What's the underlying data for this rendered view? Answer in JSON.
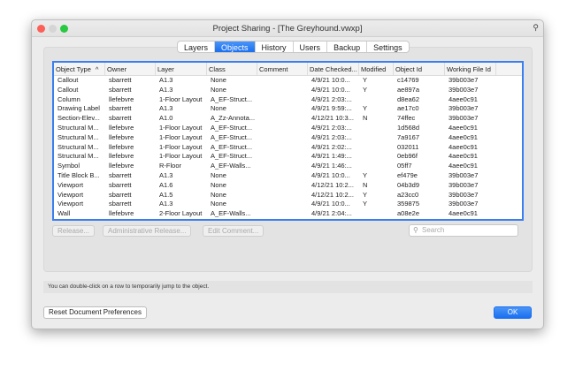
{
  "window": {
    "title": "Project Sharing - [The Greyhound.vwxp]"
  },
  "tabs": [
    {
      "label": "Layers"
    },
    {
      "label": "Objects"
    },
    {
      "label": "History"
    },
    {
      "label": "Users"
    },
    {
      "label": "Backup"
    },
    {
      "label": "Settings"
    }
  ],
  "active_tab": "Objects",
  "table": {
    "columns": [
      "Object Type",
      "Owner",
      "Layer",
      "Class",
      "Comment",
      "Date Checked...",
      "Modified",
      "Object Id",
      "Working File Id"
    ],
    "sort_indicator": "^",
    "rows": [
      [
        "Callout",
        "sbarrett",
        "A1.3",
        "None",
        "",
        "4/9/21  10:0...",
        "Y",
        "c14769",
        "39b003e7"
      ],
      [
        "Callout",
        "sbarrett",
        "A1.3",
        "None",
        "",
        "4/9/21  10:0...",
        "Y",
        "ae897a",
        "39b003e7"
      ],
      [
        "Column",
        "llefebvre",
        "1-Floor Layout",
        "A_EF-Struct...",
        "",
        "4/9/21  2:03:...",
        "",
        "d8ea62",
        "4aee0c91"
      ],
      [
        "Drawing Label",
        "sbarrett",
        "A1.3",
        "None",
        "",
        "4/9/21  9:59:...",
        "Y",
        "ae17c0",
        "39b003e7"
      ],
      [
        "Section-Elev...",
        "sbarrett",
        "A1.0",
        "A_Zz-Annota...",
        "",
        "4/12/21  10:3...",
        "N",
        "74ffec",
        "39b003e7"
      ],
      [
        "Structural M...",
        "llefebvre",
        "1-Floor Layout",
        "A_EF-Struct...",
        "",
        "4/9/21  2:03:...",
        "",
        "1d568d",
        "4aee0c91"
      ],
      [
        "Structural M...",
        "llefebvre",
        "1-Floor Layout",
        "A_EF-Struct...",
        "",
        "4/9/21  2:03:...",
        "",
        "7a9167",
        "4aee0c91"
      ],
      [
        "Structural M...",
        "llefebvre",
        "1-Floor Layout",
        "A_EF-Struct...",
        "",
        "4/9/21  2:02:...",
        "",
        "032011",
        "4aee0c91"
      ],
      [
        "Structural M...",
        "llefebvre",
        "1-Floor Layout",
        "A_EF-Struct...",
        "",
        "4/9/21  1:49:...",
        "",
        "0eb96f",
        "4aee0c91"
      ],
      [
        "Symbol",
        "llefebvre",
        "R-Floor",
        "A_EF-Walls...",
        "",
        "4/9/21  1:46:...",
        "",
        "05ff7",
        "4aee0c91"
      ],
      [
        "Title Block B...",
        "sbarrett",
        "A1.3",
        "None",
        "",
        "4/9/21  10:0...",
        "Y",
        "ef479e",
        "39b003e7"
      ],
      [
        "Viewport",
        "sbarrett",
        "A1.6",
        "None",
        "",
        "4/12/21  10:2...",
        "N",
        "04b3d9",
        "39b003e7"
      ],
      [
        "Viewport",
        "sbarrett",
        "A1.5",
        "None",
        "",
        "4/12/21  10:2...",
        "Y",
        "a23cc0",
        "39b003e7"
      ],
      [
        "Viewport",
        "sbarrett",
        "A1.3",
        "None",
        "",
        "4/9/21  10:0...",
        "Y",
        "359875",
        "39b003e7"
      ],
      [
        "Wall",
        "llefebvre",
        "2-Floor Layout",
        "A_EF-Walls...",
        "",
        "4/9/21  2:04:...",
        "",
        "a08e2e",
        "4aee0c91"
      ]
    ]
  },
  "buttons": {
    "release": "Release...",
    "admin_release": "Administrative Release...",
    "edit_comment": "Edit Comment...",
    "reset": "Reset Document Preferences",
    "ok": "OK"
  },
  "search": {
    "placeholder": "Search"
  },
  "status_text": "You can double-click on a row to temporarily jump to the object.",
  "colors": {
    "accent": "#1a6ff0",
    "close": "#fc5f57",
    "minimize": "#d5d5d5",
    "zoom": "#28c840"
  }
}
